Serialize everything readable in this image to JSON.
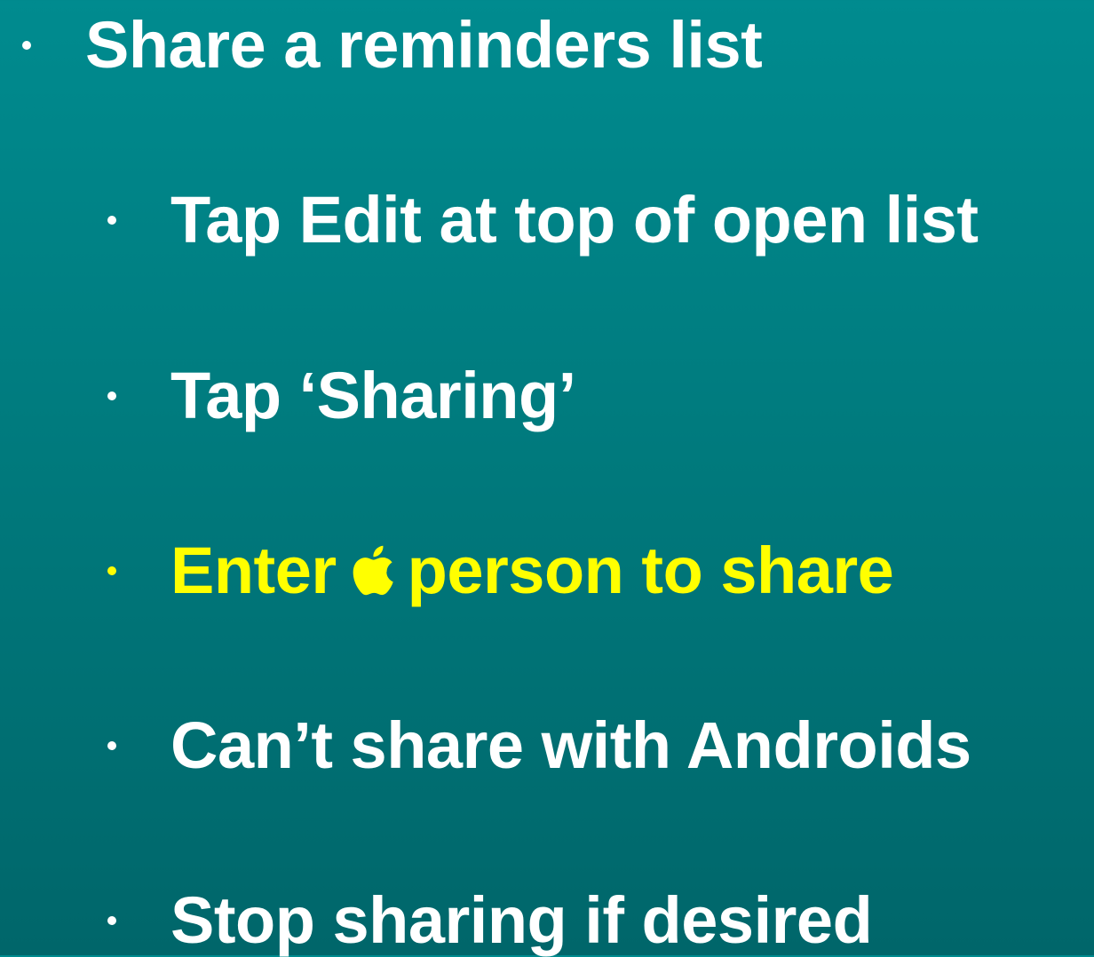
{
  "slide": {
    "bullets": [
      {
        "level": 1,
        "text": "Share a reminders list"
      },
      {
        "level": 2,
        "text": "Tap Edit at top of open list"
      },
      {
        "level": 2,
        "text": "Tap ‘Sharing’"
      },
      {
        "level": 2,
        "text_before": "Enter",
        "icon": "apple-logo-icon",
        "text_after": "person to share",
        "color": "#ffff00"
      },
      {
        "level": 2,
        "text": "Can’t share with Androids"
      },
      {
        "level": 2,
        "text": "Stop sharing if desired"
      }
    ]
  },
  "colors": {
    "background_top": "#008b8f",
    "background_bottom": "#00666a",
    "text": "#ffffff",
    "highlight": "#ffff00"
  }
}
